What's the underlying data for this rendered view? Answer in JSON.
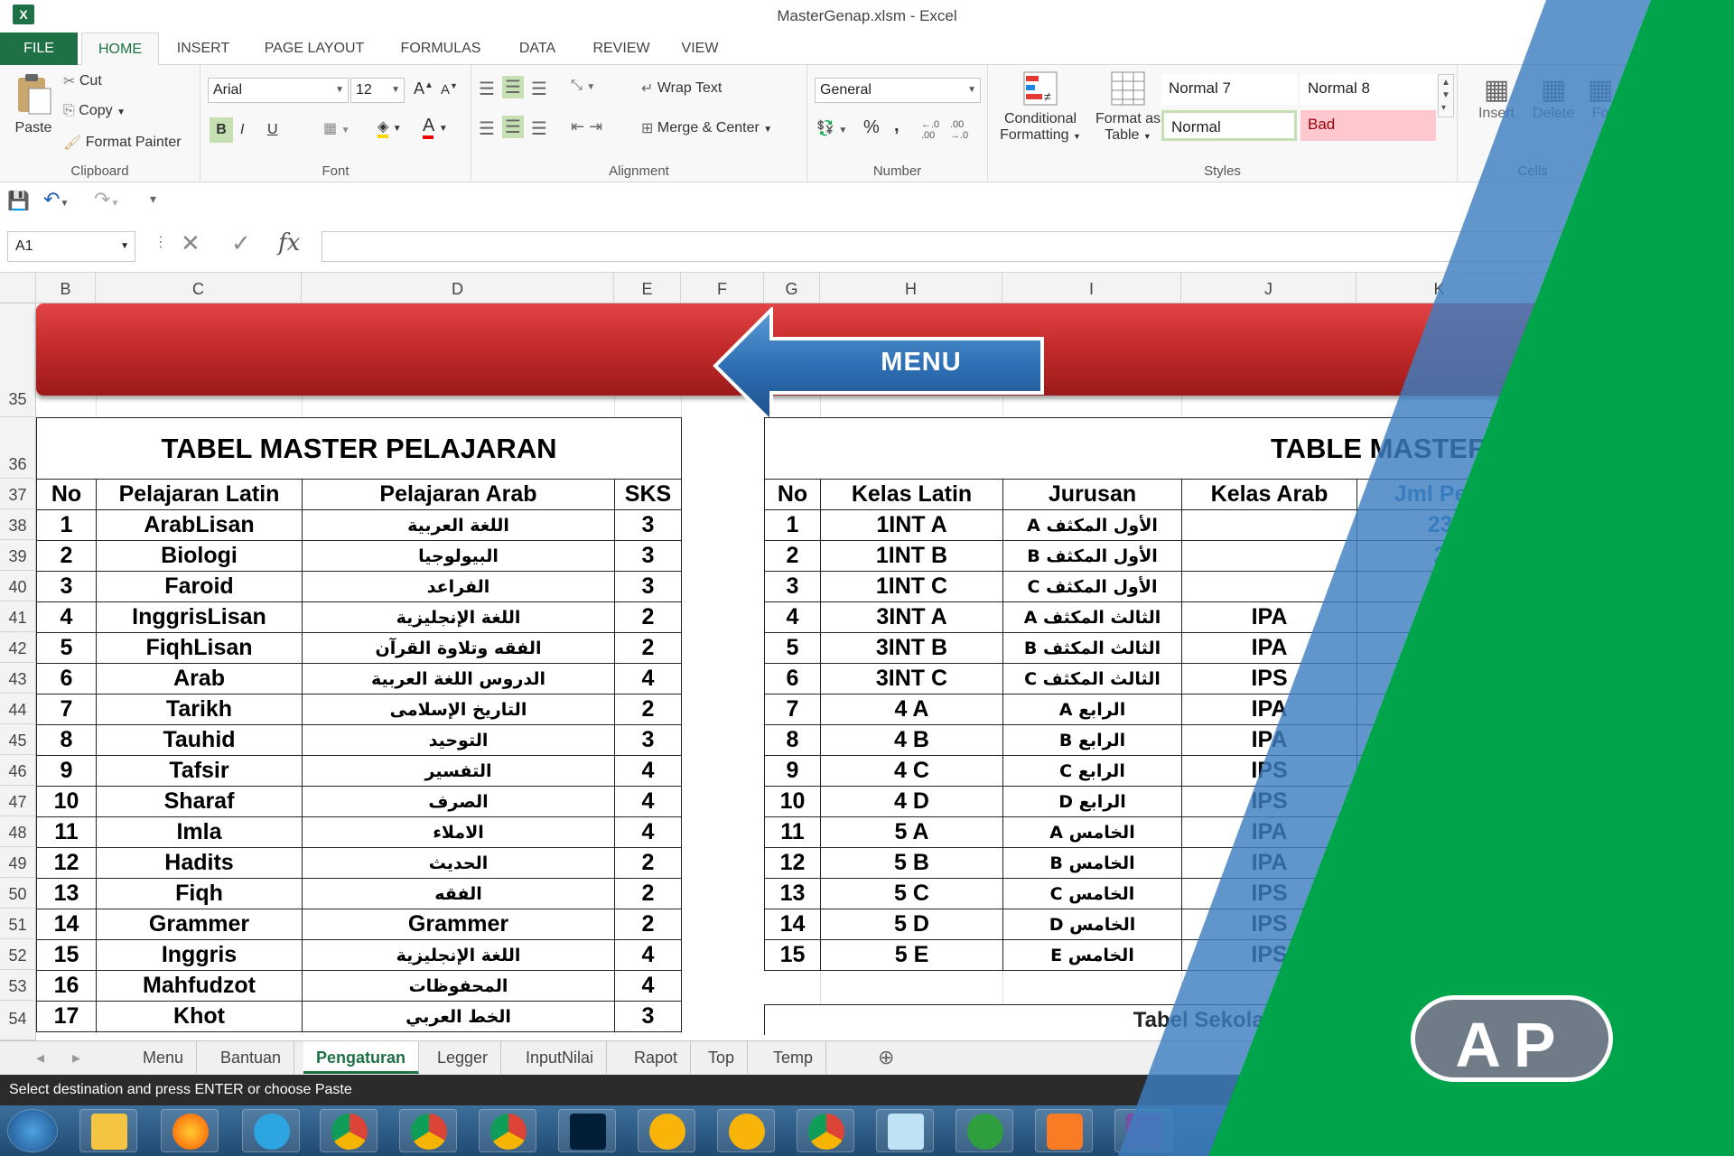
{
  "window": {
    "title": "MasterGenap.xlsm - Excel",
    "app_icon": "excel-icon"
  },
  "ribbon_tabs": [
    "FILE",
    "HOME",
    "INSERT",
    "PAGE LAYOUT",
    "FORMULAS",
    "DATA",
    "REVIEW",
    "VIEW"
  ],
  "clipboard": {
    "paste": "Paste",
    "cut": "Cut",
    "copy": "Copy",
    "format_painter": "Format Painter",
    "label": "Clipboard"
  },
  "font": {
    "name": "Arial",
    "size": "12",
    "label": "Font",
    "bold": "B",
    "italic": "I",
    "underline": "U"
  },
  "alignment": {
    "wrap": "Wrap Text",
    "merge": "Merge & Center",
    "label": "Alignment"
  },
  "number": {
    "format": "General",
    "percent": "%",
    "comma": ",",
    "label": "Number"
  },
  "styles": {
    "conditional": "Conditional",
    "conditional2": "Formatting",
    "format_table": "Format as",
    "format_table2": "Table",
    "normal7": "Normal 7",
    "normal8": "Normal 8",
    "normal": "Normal",
    "bad": "Bad",
    "label": "Styles"
  },
  "cells": {
    "insert": "Insert",
    "delete": "Delete",
    "format": "Fo",
    "label": "Cells"
  },
  "formula_bar": {
    "name_box": "A1",
    "fx": "fx",
    "value": ""
  },
  "columns": [
    "B",
    "C",
    "D",
    "E",
    "F",
    "G",
    "H",
    "I",
    "J",
    "K"
  ],
  "rows": [
    "35",
    "36",
    "37",
    "38",
    "39",
    "40",
    "41",
    "42",
    "43",
    "44",
    "45",
    "46",
    "47",
    "48",
    "49",
    "50",
    "51",
    "52",
    "53",
    "54"
  ],
  "menu_button": "MENU",
  "left_table": {
    "title": "TABEL MASTER PELAJARAN",
    "headers": [
      "No",
      "Pelajaran Latin",
      "Pelajaran Arab",
      "SKS"
    ],
    "rows": [
      [
        "1",
        "ArabLisan",
        "اللغة العربية",
        "3"
      ],
      [
        "2",
        "Biologi",
        "البيولوجيا",
        "3"
      ],
      [
        "3",
        "Faroid",
        "الفراعد",
        "3"
      ],
      [
        "4",
        "InggrisLisan",
        "اللغة الإنجليزية",
        "2"
      ],
      [
        "5",
        "FiqhLisan",
        "الفقه وتلاوة القرآن",
        "2"
      ],
      [
        "6",
        "Arab",
        "الدروس اللغة العربية",
        "4"
      ],
      [
        "7",
        "Tarikh",
        "التاريخ الإسلامى",
        "2"
      ],
      [
        "8",
        "Tauhid",
        "التوحيد",
        "3"
      ],
      [
        "9",
        "Tafsir",
        "التفسير",
        "4"
      ],
      [
        "10",
        "Sharaf",
        "الصرف",
        "4"
      ],
      [
        "11",
        "Imla",
        "الاملاء",
        "4"
      ],
      [
        "12",
        "Hadits",
        "الحديث",
        "2"
      ],
      [
        "13",
        "Fiqh",
        "الفقه",
        "2"
      ],
      [
        "14",
        "Grammer",
        "Grammer",
        "2"
      ],
      [
        "15",
        "Inggris",
        "اللغة الإنجليزية",
        "4"
      ],
      [
        "16",
        "Mahfudzot",
        "المحفوظات",
        "4"
      ],
      [
        "17",
        "Khot",
        "الخط العربي",
        "3"
      ]
    ]
  },
  "right_table": {
    "title": "TABLE MASTER K",
    "headers": [
      "No",
      "Kelas Latin",
      "Jurusan",
      "Kelas Arab",
      "Jml Pela"
    ],
    "rows": [
      [
        "1",
        "1INT A",
        "A الأول المكثف",
        "",
        "23"
      ],
      [
        "2",
        "1INT B",
        "B الأول المكثف",
        "",
        "2"
      ],
      [
        "3",
        "1INT C",
        "C الأول المكثف",
        "",
        ""
      ],
      [
        "4",
        "3INT A",
        "A الثالث المكثف",
        "IPA",
        ""
      ],
      [
        "5",
        "3INT B",
        "B الثالث المكثف",
        "IPA",
        ""
      ],
      [
        "6",
        "3INT C",
        "C الثالث المكثف",
        "IPS",
        ""
      ],
      [
        "7",
        "4 A",
        "A الرابع",
        "IPA",
        ""
      ],
      [
        "8",
        "4 B",
        "B الرابع",
        "IPA",
        ""
      ],
      [
        "9",
        "4 C",
        "C الرابع",
        "IPS",
        ""
      ],
      [
        "10",
        "4 D",
        "D الرابع",
        "IPS",
        ""
      ],
      [
        "11",
        "5 A",
        "A الخامس",
        "IPA",
        ""
      ],
      [
        "12",
        "5 B",
        "B الخامس",
        "IPA",
        ""
      ],
      [
        "13",
        "5 C",
        "C الخامس",
        "IPS",
        ""
      ],
      [
        "14",
        "5 D",
        "D الخامس",
        "IPS",
        ""
      ],
      [
        "15",
        "5 E",
        "E الخامس",
        "IPS",
        ""
      ]
    ]
  },
  "sekolah_title": "Tabel Sekolah dan Tah",
  "sheet_tabs": [
    "Menu",
    "Bantuan",
    "Pengaturan",
    "Legger",
    "InputNilai",
    "Rapot",
    "Top",
    "Temp"
  ],
  "active_sheet": "Pengaturan",
  "status": "Select destination and press ENTER or choose Paste",
  "logo": "AP",
  "colors": {
    "excel_green": "#1e7145",
    "banner_red": "#c62b2b",
    "overlay_blue": "#3d7fc0",
    "overlay_green": "#00a44a"
  }
}
